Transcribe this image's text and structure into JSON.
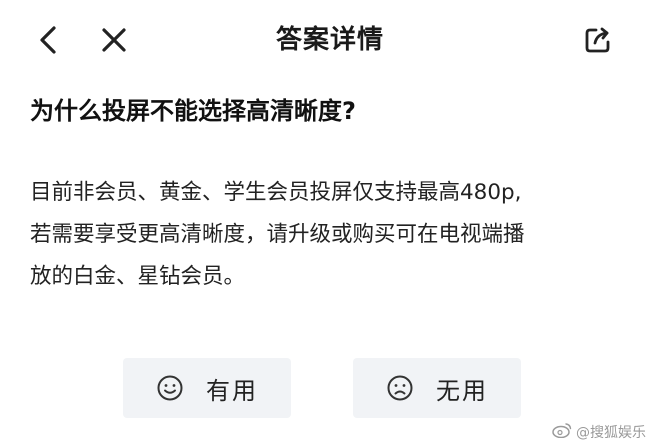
{
  "header": {
    "title": "答案详情",
    "back_icon": "back-chevron-icon",
    "close_icon": "close-icon",
    "share_icon": "share-icon"
  },
  "question": "为什么投屏不能选择高清晰度?",
  "answer": {
    "lines": [
      "目前非会员、黄金、学生会员投屏仅支持最高480p,",
      "若需要享受更高清晰度，请升级或购买可在电视端播",
      "放的白金、星钻会员。"
    ]
  },
  "feedback": {
    "useful_label": "有用",
    "useless_label": "无用",
    "useful_icon": "smile-icon",
    "useless_icon": "frown-icon"
  },
  "watermark": {
    "text": "@搜狐娱乐",
    "icon": "weibo-icon"
  },
  "colors": {
    "text": "#111111",
    "button_bg": "#f1f3f6",
    "watermark": "#9a9a9a"
  }
}
